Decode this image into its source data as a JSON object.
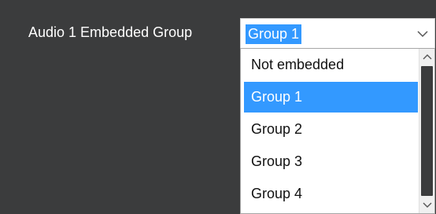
{
  "field": {
    "label": "Audio 1 Embedded Group",
    "selected_value": "Group 1",
    "dropdown_icon": "chevron-down-icon"
  },
  "dropdown": {
    "options": [
      "Not embedded",
      "Group 1",
      "Group 2",
      "Group 3",
      "Group 4"
    ],
    "highlighted_index": 1,
    "scroll_up_icon": "chevron-up-icon",
    "scroll_down_icon": "chevron-down-icon"
  },
  "colors": {
    "background": "#3b3c3d",
    "highlight": "#3399ff",
    "list_bg": "#ffffff",
    "label_text": "#ffffff"
  }
}
